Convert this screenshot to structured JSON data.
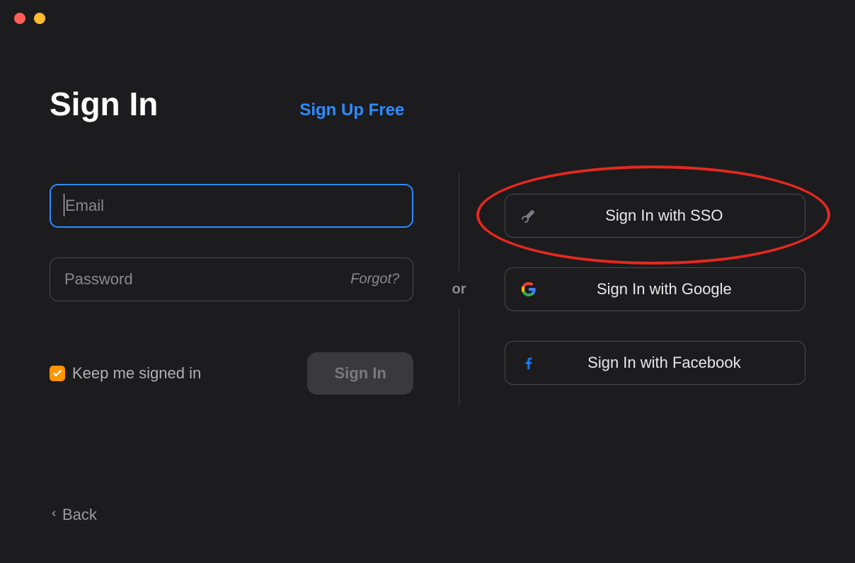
{
  "header": {
    "title": "Sign In",
    "signup_link": "Sign Up Free"
  },
  "form": {
    "email_placeholder": "Email",
    "email_value": "",
    "password_placeholder": "Password",
    "password_value": "",
    "forgot_label": "Forgot?",
    "keep_signed_label": "Keep me signed in",
    "keep_signed_checked": true,
    "signin_button": "Sign In"
  },
  "divider": {
    "text": "or"
  },
  "social": {
    "sso_label": "Sign In with SSO",
    "google_label": "Sign In with Google",
    "facebook_label": "Sign In with Facebook"
  },
  "footer": {
    "back_label": "Back"
  }
}
